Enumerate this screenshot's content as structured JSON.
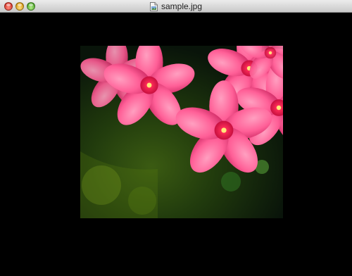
{
  "window": {
    "title": "sample.jpg",
    "document_icon": "image-file-icon",
    "controls": [
      "close-icon",
      "minimize-icon",
      "zoom-icon"
    ]
  },
  "image": {
    "subject": "pink-flower-photo"
  },
  "colors": {
    "content_background": "#000000",
    "titlebar_top": "#ececec",
    "titlebar_bottom": "#c9c9c9"
  }
}
